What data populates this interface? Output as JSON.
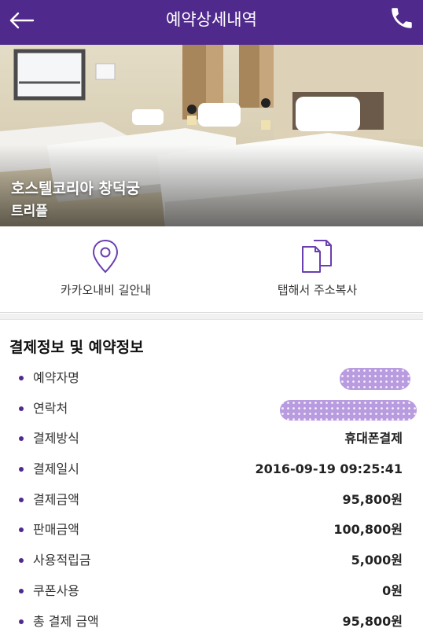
{
  "header": {
    "title": "예약상세내역",
    "back_icon": "arrow-left-icon",
    "call_icon": "phone-icon",
    "background": "#4f2a8c"
  },
  "hotel": {
    "name": "호스텔코리아 창덕궁",
    "room_type": "트리플"
  },
  "actions": [
    {
      "label": "카카오내비 길안내",
      "icon": "map-pin-icon"
    },
    {
      "label": "탭해서 주소복사",
      "icon": "copy-icon"
    }
  ],
  "section": {
    "title": "결제정보 및 예약정보",
    "rows": [
      {
        "label": "예약자명",
        "value": ""
      },
      {
        "label": "연락처",
        "value": ""
      },
      {
        "label": "결제방식",
        "value": "휴대폰결제"
      },
      {
        "label": "결제일시",
        "value": "2016-09-19 09:25:41"
      },
      {
        "label": "결제금액",
        "value": "95,800원"
      },
      {
        "label": "판매금액",
        "value": "100,800원"
      },
      {
        "label": "사용적립금",
        "value": "5,000원"
      },
      {
        "label": "쿠폰사용",
        "value": "0원"
      },
      {
        "label": "총 결제 금액",
        "value": "95,800원"
      }
    ]
  },
  "colors": {
    "accent": "#4f2a8c",
    "redaction": "#b99be0"
  }
}
